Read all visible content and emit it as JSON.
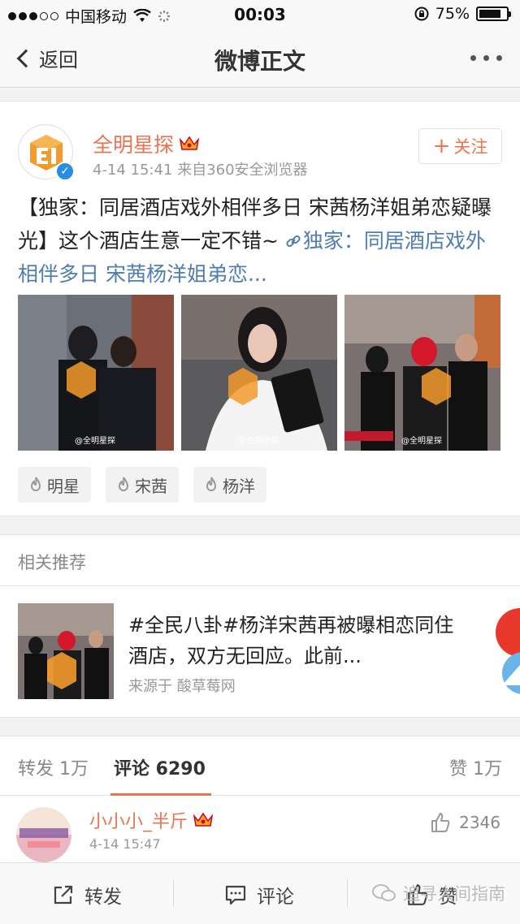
{
  "status_bar": {
    "carrier": "中国移动",
    "time": "00:03",
    "battery_percent": "75%"
  },
  "nav": {
    "back_label": "返回",
    "title": "微博正文"
  },
  "post": {
    "author": "全明星探",
    "date": "4-14 15:41",
    "source": "来自360安全浏览器",
    "follow_label": "关注",
    "text_main": "【独家：同居酒店戏外相伴多日 宋茜杨洋姐弟恋疑曝光】这个酒店生意一定不错~ ",
    "link_text": "独家：同居酒店戏外相伴多日 宋茜杨洋姐弟恋...",
    "photo_watermark": "@全明星探",
    "tags": [
      "明星",
      "宋茜",
      "杨洋"
    ]
  },
  "related": {
    "heading": "相关推荐",
    "title": "#全民八卦#杨洋宋茜再被曝相恋同住酒店，双方无回应。此前...",
    "source": "来源于 酸草莓网"
  },
  "tabs": {
    "repost": "转发 1万",
    "comments": "评论 6290",
    "likes": "赞 1万"
  },
  "comment": {
    "username": "小小小_半斤",
    "time": "4-14 15:47",
    "likes": "2346"
  },
  "toolbar": {
    "repost": "转发",
    "comment": "评论",
    "like": "赞",
    "watermark": "追寻人间指南"
  },
  "colors": {
    "accent": "#eb7350",
    "link": "#507daf",
    "logo_orange": "#f39a2b"
  }
}
